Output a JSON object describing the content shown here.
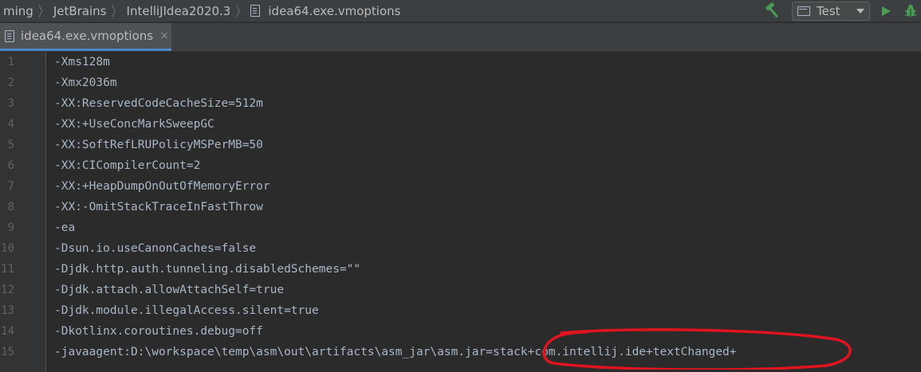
{
  "navbar": {
    "breadcrumbs": [
      "ming",
      "JetBrains",
      "IntelliJIdea2020.3",
      "idea64.exe.vmoptions"
    ],
    "run_config": "Test"
  },
  "tab": {
    "label": "idea64.exe.vmoptions",
    "close": "×"
  },
  "editor": {
    "lines": [
      {
        "n": "1",
        "text": "-Xms128m"
      },
      {
        "n": "2",
        "text": "-Xmx2036m"
      },
      {
        "n": "3",
        "text": "-XX:ReservedCodeCacheSize=512m"
      },
      {
        "n": "4",
        "text": "-XX:+UseConcMarkSweepGC"
      },
      {
        "n": "5",
        "text": "-XX:SoftRefLRUPolicyMSPerMB=50"
      },
      {
        "n": "6",
        "text": "-XX:CICompilerCount=2"
      },
      {
        "n": "7",
        "text": "-XX:+HeapDumpOnOutOfMemoryError"
      },
      {
        "n": "8",
        "text": "-XX:-OmitStackTraceInFastThrow"
      },
      {
        "n": "9",
        "text": "-ea"
      },
      {
        "n": "10",
        "text": "-Dsun.io.useCanonCaches=false"
      },
      {
        "n": "11",
        "text": "-Djdk.http.auth.tunneling.disabledSchemes=\"\""
      },
      {
        "n": "12",
        "text": "-Djdk.attach.allowAttachSelf=true"
      },
      {
        "n": "13",
        "text": "-Djdk.module.illegalAccess.silent=true"
      },
      {
        "n": "14",
        "text": "-Dkotlinx.coroutines.debug=off"
      },
      {
        "n": "15",
        "text": "-javaagent:D:\\workspace\\temp\\asm\\out\\artifacts\\asm_jar\\asm.jar=stack+com.intellij.ide+textChanged+"
      }
    ]
  },
  "colors": {
    "annotation": "#e0141e",
    "run": "#499c54",
    "hammer": "#499c54",
    "tab_underline": "#4a88c7"
  }
}
